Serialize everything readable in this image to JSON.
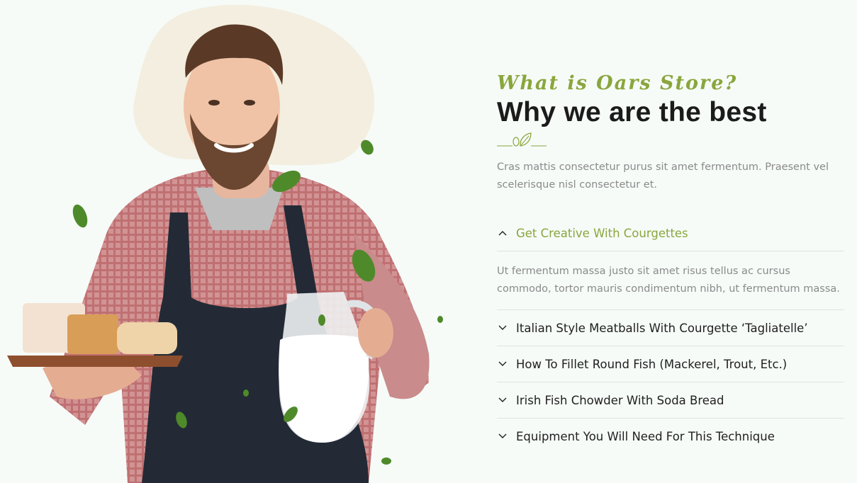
{
  "section": {
    "script_title": "What is Oars Store?",
    "title": "Why we are the best",
    "intro": "Cras mattis consectetur purus sit amet fermentum. Praesent vel scelerisque nisl consectetur et."
  },
  "accordion": [
    {
      "label": "Get Creative With Courgettes",
      "open": true,
      "body": "Ut fermentum massa justo sit amet risus tellus ac cursus commodo, tortor mauris condimentum nibh, ut fermentum massa."
    },
    {
      "label": "Italian Style Meatballs With Courgette ‘Tagliatelle’",
      "open": false
    },
    {
      "label": "How To Fillet Round Fish (Mackerel, Trout, Etc.)",
      "open": false
    },
    {
      "label": "Irish Fish Chowder With Soda Bread",
      "open": false
    },
    {
      "label": "Equipment You Will Need For This Technique",
      "open": false
    }
  ],
  "icons": {
    "expanded": "chevron-up-icon",
    "collapsed": "chevron-down-icon",
    "ornament": "leaf-divider-icon"
  },
  "colors": {
    "accent": "#8aa63c",
    "heading": "#1b1b1b",
    "text": "#8a8a8a",
    "background": "#f6fbf8"
  }
}
